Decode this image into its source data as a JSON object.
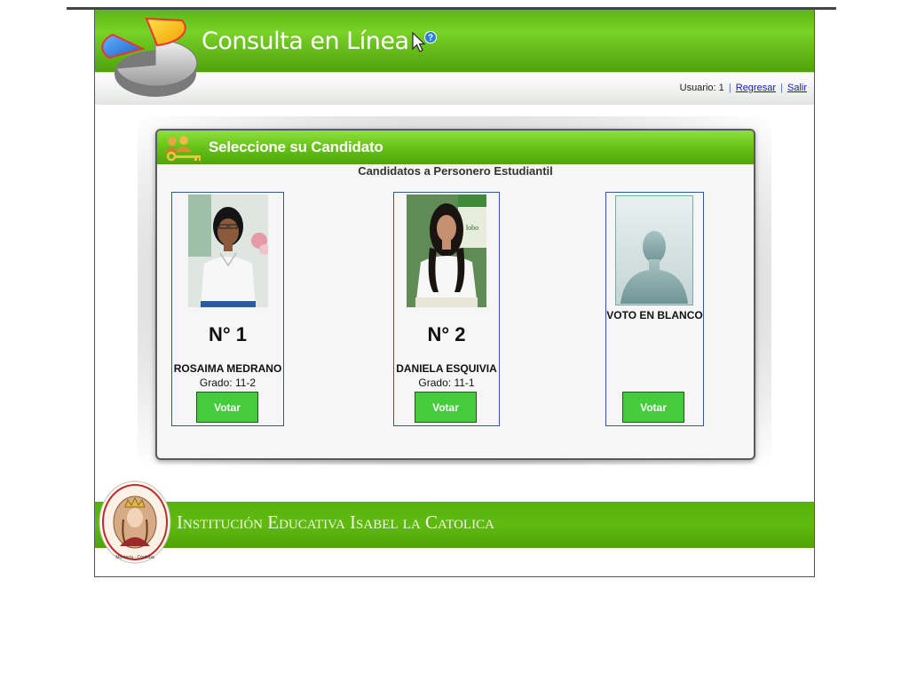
{
  "header": {
    "title": "Consulta en Línea"
  },
  "userbar": {
    "user_text": "Usuario: 1",
    "sep1": "|",
    "back_link": "Regresar",
    "sep2": "|",
    "logout_link": "Salir"
  },
  "panel": {
    "title": "Seleccione su Candidato",
    "subtitle": "Candidatos a Personero Estudiantil"
  },
  "candidates": [
    {
      "number": "N° 1",
      "name": "ROSAIMA MEDRANO",
      "grade": "Grado: 11-2",
      "button": "Votar"
    },
    {
      "number": "N° 2",
      "name": "DANIELA ESQUIVIA",
      "grade": "Grado: 11-1",
      "button": "Votar"
    }
  ],
  "blank_vote": {
    "label": "VOTO EN BLANCO",
    "button": "Votar"
  },
  "footer": {
    "institution": "Institución Educativa Isabel la Catolica",
    "seal_text": "INSTITUCIÓN EDUCATIVA ISABEL LA CATÓLICA · Montería - Córdoba"
  },
  "icons": {
    "logo": "pie-chart-icon",
    "cursor": "cursor-help-icon",
    "panel": "people-key-icon",
    "blank_avatar": "user-silhouette-icon"
  },
  "colors": {
    "brand_green": "#5db514",
    "vote_button": "#44cc3c",
    "card_border": "#2d5a96"
  }
}
